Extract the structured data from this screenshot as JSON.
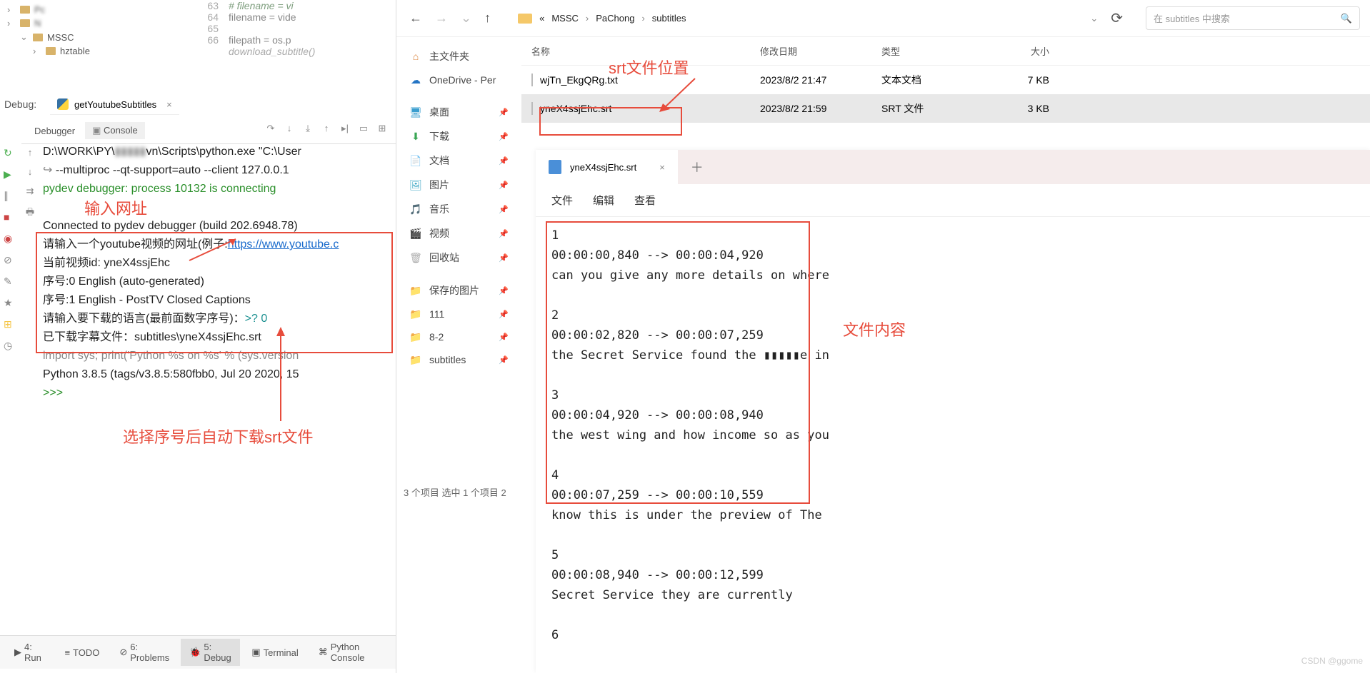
{
  "ide": {
    "tree": {
      "mssc": "MSSC",
      "hztable": "hztable",
      "pc_placeholder": "Pc",
      "n_placeholder": "N"
    },
    "code": {
      "lines": [
        {
          "n": "63",
          "t": "# filename = vi",
          "cls": "comment"
        },
        {
          "n": "64",
          "t": "filename = vide"
        },
        {
          "n": "65",
          "t": ""
        },
        {
          "n": "66",
          "t": "filepath = os.p"
        }
      ],
      "hint": "download_subtitle()"
    },
    "debug_label": "Debug:",
    "run_config": "getYoutubeSubtitles",
    "tabs": {
      "debugger": "Debugger",
      "console": "Console"
    },
    "console": {
      "l1a": "D:\\WORK\\PY\\",
      "l1b": "vn\\Scripts\\python.exe \"C:\\User",
      "l2": "--multiproc --qt-support=auto --client 127.0.0.1",
      "l3": "pydev debugger: process 10132 is connecting",
      "l4": "Connected to pydev debugger (build 202.6948.78)",
      "l5a": "请输入一个youtube视频的网址(例子:",
      "l5b": "https://www.youtube.c",
      "l6": "当前视频id: yneX4ssjEhc",
      "l7": "序号:0 English (auto-generated)",
      "l8": "序号:1 English - PostTV Closed Captions",
      "l9a": "请输入要下载的语言(最前面数字序号)：",
      "l9b": ">? ",
      "l9c": "0",
      "l10": "已下载字幕文件：subtitles\\yneX4ssjEhc.srt",
      "l11": "import sys; print('Python %s on %s' % (sys.version",
      "l12": "Python 3.8.5 (tags/v3.8.5:580fbb0, Jul 20 2020, 15",
      "l13": ">>>"
    },
    "bottom": {
      "run": "4: Run",
      "todo": "TODO",
      "problems": "6: Problems",
      "debug": "5: Debug",
      "terminal": "Terminal",
      "pyc": "Python Console"
    }
  },
  "annotations": {
    "a1": "输入网址",
    "a2": "选择序号后自动下载srt文件",
    "a3": "srt文件位置",
    "a4": "文件内容"
  },
  "explorer": {
    "path": {
      "root": "«",
      "p1": "MSSC",
      "p2": "PaChong",
      "p3": "subtitles"
    },
    "search_placeholder": "在 subtitles 中搜索",
    "cols": {
      "name": "名称",
      "date": "修改日期",
      "type": "类型",
      "size": "大小"
    },
    "sidebar": {
      "home": "主文件夹",
      "onedrive": "OneDrive - Per",
      "desktop": "桌面",
      "downloads": "下载",
      "docs": "文档",
      "pics": "图片",
      "music": "音乐",
      "videos": "视频",
      "recycle": "回收站",
      "saved": "保存的图片",
      "f111": "111",
      "f82": "8-2",
      "fsub": "subtitles"
    },
    "rows": [
      {
        "name": "wjTn_EkgQRg.txt",
        "date": "2023/8/2 21:47",
        "type": "文本文档",
        "size": "7 KB",
        "sel": false
      },
      {
        "name": "yneX4ssjEhc.srt",
        "date": "2023/8/2 21:59",
        "type": "SRT 文件",
        "size": "3 KB",
        "sel": true
      }
    ],
    "status": "3 个项目    选中 1 个项目 2"
  },
  "notepad": {
    "title": "yneX4ssjEhc.srt",
    "menu": {
      "file": "文件",
      "edit": "编辑",
      "view": "查看"
    },
    "content": "1\n00:00:00,840 --> 00:00:04,920\ncan you give any more details on where\n\n2\n00:00:02,820 --> 00:00:07,259\nthe Secret Service found the ▮▮▮▮▮e in\n\n3\n00:00:04,920 --> 00:00:08,940\nthe west wing and how income so as you\n\n4\n00:00:07,259 --> 00:00:10,559\nknow this is under the preview of The\n\n5\n00:00:08,940 --> 00:00:12,599\nSecret Service they are currently\n\n6"
  },
  "watermark": "CSDN @ggome"
}
